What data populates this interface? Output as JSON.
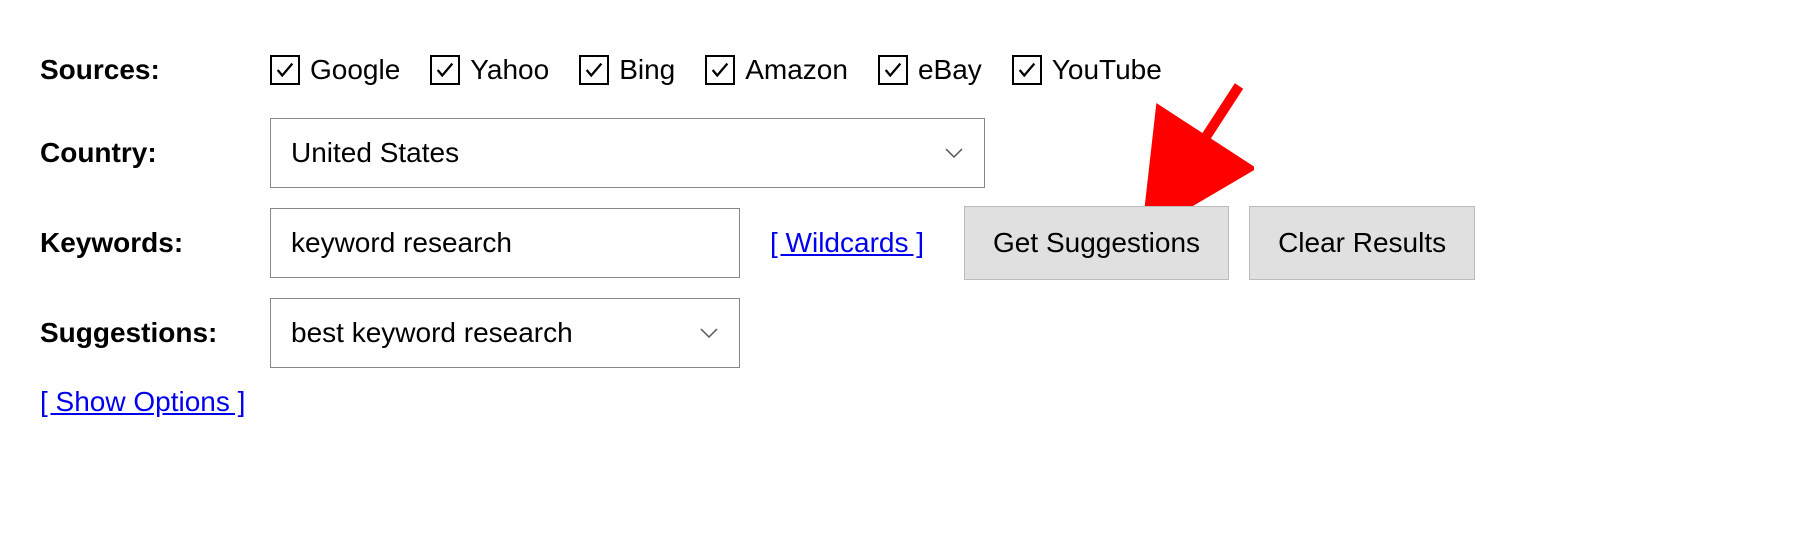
{
  "labels": {
    "sources": "Sources:",
    "country": "Country:",
    "keywords": "Keywords:",
    "suggestions": "Suggestions:"
  },
  "sources": {
    "google": "Google",
    "yahoo": "Yahoo",
    "bing": "Bing",
    "amazon": "Amazon",
    "ebay": "eBay",
    "youtube": "YouTube"
  },
  "country": {
    "selected": "United States"
  },
  "keywords": {
    "value": "keyword research",
    "wildcards_link": "[ Wildcards ]"
  },
  "buttons": {
    "get_suggestions": "Get Suggestions",
    "clear_results": "Clear Results"
  },
  "suggestions_select": {
    "selected": "best keyword research"
  },
  "show_options": "[ Show Options ]"
}
